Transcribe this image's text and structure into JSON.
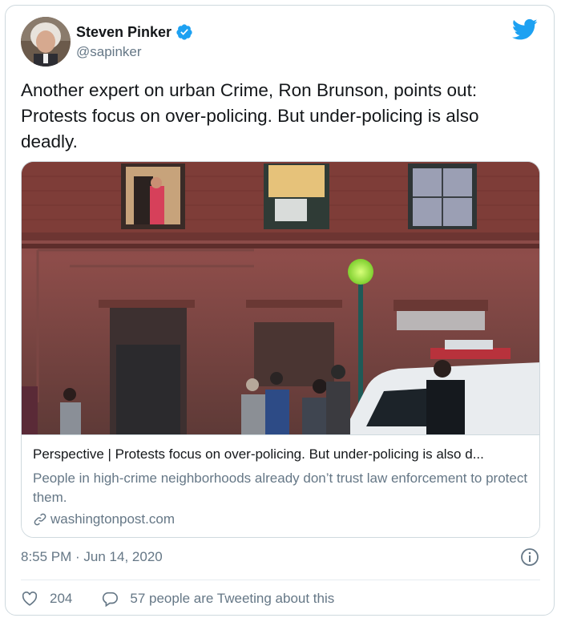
{
  "author": {
    "name": "Steven Pinker",
    "handle": "@sapinker"
  },
  "tweet_text": "Another expert on urban Crime, Ron Brunson, points out: Protests focus on over-policing. But under-policing is also deadly.",
  "card": {
    "title": "Perspective | Protests focus on over-policing. But under-policing is also d...",
    "description": "People in high-crime neighborhoods already don’t trust law enforcement to protect them.",
    "domain": "washingtonpost.com"
  },
  "timestamp": "8:55 PM · Jun 14, 2020",
  "stats": {
    "likes": "204",
    "conversation": "57 people are Tweeting about this"
  },
  "colors": {
    "twitter_blue": "#1da1f2",
    "secondary_text": "#657786",
    "border": "#cfd9de"
  },
  "icons": [
    "verified-badge-icon",
    "twitter-bird-icon",
    "link-icon",
    "info-icon",
    "heart-icon",
    "reply-icon"
  ]
}
